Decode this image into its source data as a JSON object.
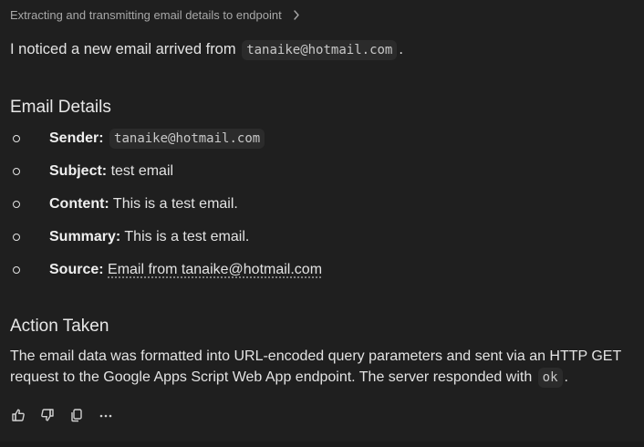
{
  "breadcrumb": {
    "title": "Extracting and transmitting email details to endpoint"
  },
  "intro": {
    "text_before": "I noticed a new email arrived from",
    "email": "tanaike@hotmail.com",
    "text_after": "."
  },
  "email_details": {
    "heading": "Email Details",
    "sender_label": "Sender:",
    "sender_value": "tanaike@hotmail.com",
    "subject_label": "Subject:",
    "subject_value": "test email",
    "content_label": "Content:",
    "content_value": "This is a test email.",
    "summary_label": "Summary:",
    "summary_value": "This is a test email.",
    "source_label": "Source:",
    "source_value": "Email from tanaike@hotmail.com"
  },
  "action": {
    "heading": "Action Taken",
    "text": "The email data was formatted into URL-encoded query parameters and sent via an HTTP GET request to the Google Apps Script Web App endpoint. The server responded with",
    "code": "ok",
    "text_after": "."
  },
  "toolbar": {
    "icons": [
      "thumbs-up-icon",
      "thumbs-down-icon",
      "copy-icon",
      "more-icon"
    ]
  }
}
